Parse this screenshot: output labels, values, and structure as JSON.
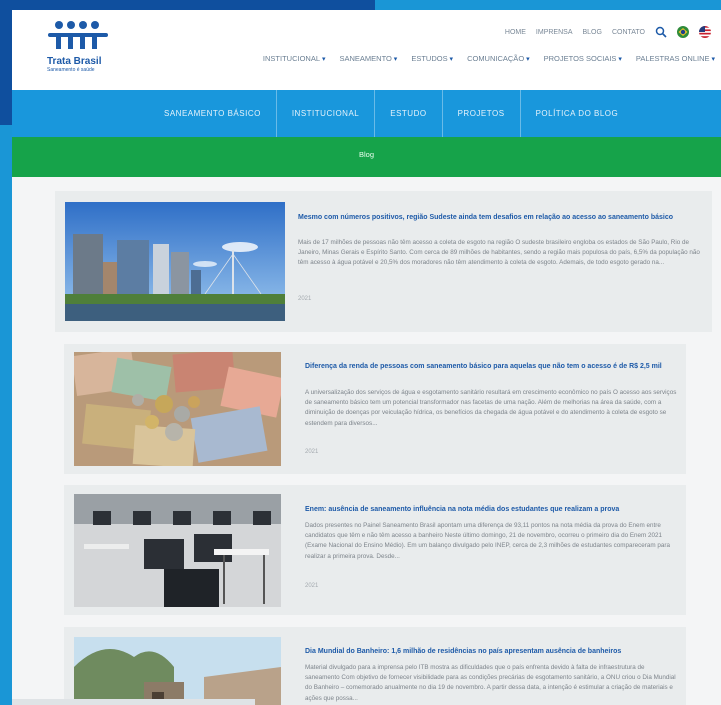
{
  "logo": {
    "name": "Trata Brasil",
    "tagline": "Saneamento é saúde"
  },
  "topnav": {
    "items": [
      "HOME",
      "IMPRENSA",
      "BLOG",
      "CONTATO"
    ]
  },
  "mainnav": {
    "items": [
      "INSTITUCIONAL",
      "SANEAMENTO",
      "ESTUDOS",
      "COMUNICAÇÃO",
      "PROJETOS SOCIAIS",
      "PALESTRAS ONLINE"
    ]
  },
  "subnav": {
    "items": [
      "SANEAMENTO BÁSICO",
      "INSTITUCIONAL",
      "ESTUDO",
      "PROJETOS",
      "POLÍTICA DO BLOG"
    ]
  },
  "section_title": "Blog",
  "posts": [
    {
      "title": "Mesmo com números positivos, região Sudeste ainda tem desafios em relação ao acesso ao saneamento básico",
      "excerpt": "Mais de 17 milhões de pessoas não têm acesso a coleta de esgoto na região O sudeste brasileiro engloba os estados de São Paulo, Rio de Janeiro, Minas Gerais e Espírito Santo. Com cerca de 89 milhões de habitantes, sendo a região mais populosa do país, 6,5% da população não têm acesso à água potável e 20,5% dos moradores não têm atendimento à coleta de esgoto. Ademais, de todo esgoto gerado na...",
      "year": "2021"
    },
    {
      "title": "Diferença da renda de pessoas com saneamento básico para aquelas que não tem o acesso é de R$ 2,5 mil",
      "excerpt": "A universalização dos serviços de água e esgotamento sanitário resultará em crescimento econômico no país O acesso aos serviços de saneamento básico tem um potencial transformador nas facetas de uma nação. Além de melhorias na área da saúde, com a diminuição de doenças por veiculação hídrica, os benefícios da chegada de água potável e do atendimento à coleta de esgoto se estendem para diversos...",
      "year": "2021"
    },
    {
      "title": "Enem: ausência de saneamento influência na nota média dos estudantes que realizam a prova",
      "excerpt": "Dados presentes no Painel Saneamento Brasil apontam uma diferença de 93,11 pontos na nota média da prova do Enem entre candidatos que têm e não têm acesso a banheiro Neste último domingo, 21 de novembro, ocorreu o primeiro dia do Enem 2021 (Exame Nacional do Ensino Médio). Em um balanço divulgado pelo INEP, cerca de 2,3 milhões de estudantes compareceram para realizar a primeira prova. Desde...",
      "year": "2021"
    },
    {
      "title": "Dia Mundial do Banheiro: 1,6 milhão de residências no país apresentam ausência de banheiros",
      "excerpt": "Material divulgado para a imprensa pelo ITB mostra as dificuldades que o país enfrenta devido à falta de infraestrutura de saneamento Com objetivo de fornecer visibilidade para as condições precárias de esgotamento sanitário, a ONU criou o Dia Mundial do Banheiro – comemorado anualmente no dia 19 de novembro. A partir dessa data, a intenção é estimular a criação de materiais e ações que possa...",
      "year": "2021"
    }
  ],
  "colors": {
    "brand_blue": "#1d5aa8",
    "bar_blue": "#1997dc",
    "bar_green": "#16a34a"
  }
}
